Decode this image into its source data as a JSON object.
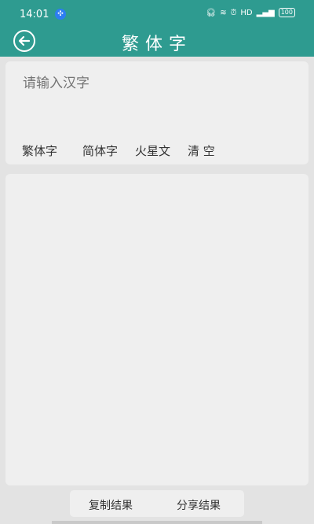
{
  "status_bar": {
    "time": "14:01",
    "indicators": [
      "headphones-icon",
      "wifi-signal-icon",
      "alarm-icon"
    ],
    "hd_label": "HD",
    "signal_label": "4G",
    "battery_level": "100"
  },
  "app_bar": {
    "title": "繁体字",
    "back_icon": "back-arrow-icon"
  },
  "input": {
    "placeholder": "请输入汉字",
    "value": ""
  },
  "actions": {
    "traditional": "繁体字",
    "simplified": "简体字",
    "martian": "火星文",
    "clear": "清 空"
  },
  "result": {
    "text": ""
  },
  "bottom": {
    "copy_label": "复制结果",
    "share_label": "分享结果"
  },
  "colors": {
    "primary": "#2e9b90",
    "background": "#e3e3e3",
    "card": "#efefef",
    "placeholder": "#bdbdbd"
  }
}
